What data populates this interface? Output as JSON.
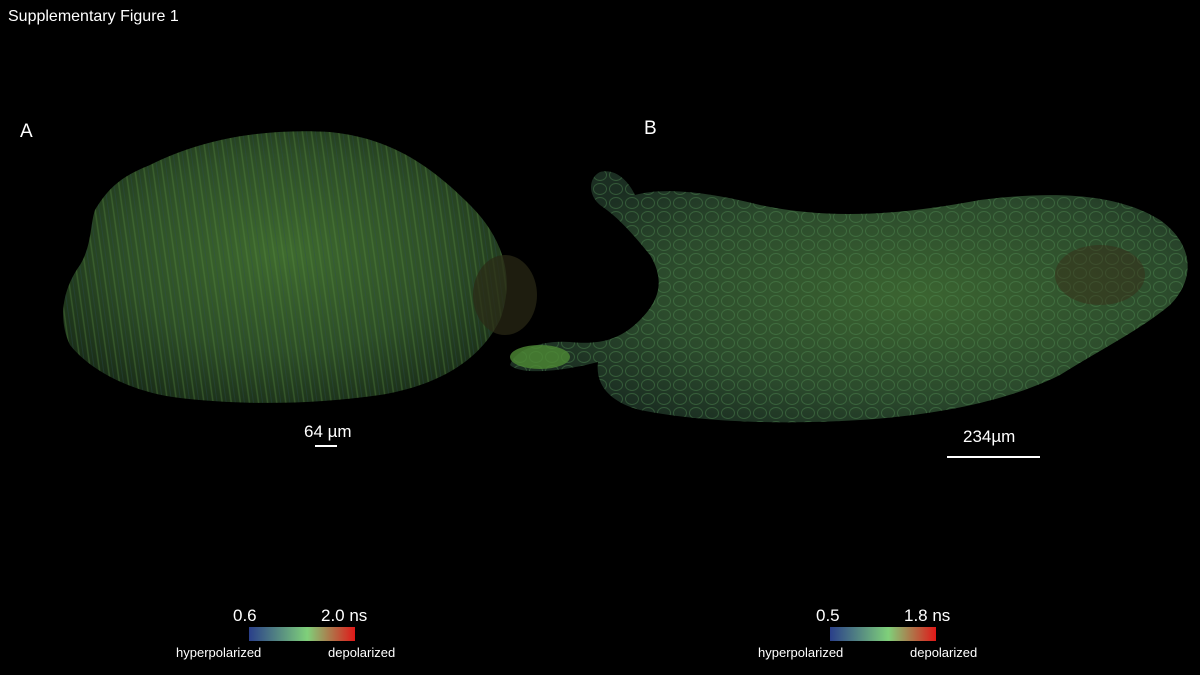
{
  "figure": {
    "title": "Supplementary Figure 1"
  },
  "panels": [
    {
      "label": "A",
      "scale_bar": {
        "text": "64 µm"
      },
      "colorbar": {
        "min": "0.6",
        "max": "2.0 ns",
        "left_word": "hyperpolarized",
        "right_word": "depolarized",
        "colors": [
          "#2a3f8a",
          "#7fd07a",
          "#e01818"
        ]
      }
    },
    {
      "label": "B",
      "scale_bar": {
        "text": "234µm"
      },
      "colorbar": {
        "min": "0.5",
        "max": "1.8 ns",
        "left_word": "hyperpolarized",
        "right_word": "depolarized",
        "colors": [
          "#2a3f8a",
          "#7fd07a",
          "#e01818"
        ]
      }
    }
  ],
  "colors": {
    "background": "#000000",
    "tissue_dark": "#1b2e17",
    "tissue_light": "#3f6a2c"
  }
}
